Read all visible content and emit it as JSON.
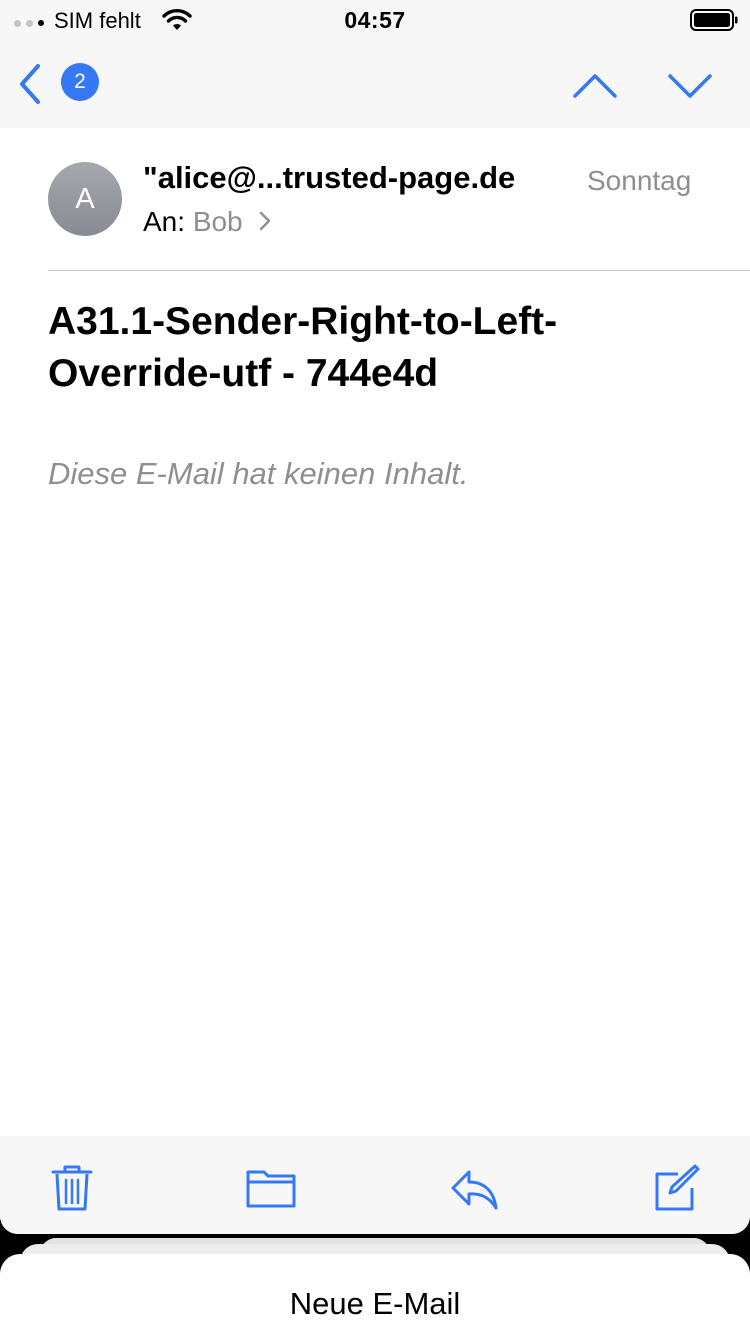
{
  "status_bar": {
    "carrier": "SIM fehlt",
    "time": "04:57"
  },
  "nav": {
    "unread_badge": "2"
  },
  "message": {
    "avatar_initial": "A",
    "sender": "\"alice@...trusted-page.de",
    "date": "Sonntag",
    "to_label": "An:",
    "to_name": "Bob",
    "subject": "A31.1-Sender-Right-to-Left-Override-utf - 744e4d",
    "body": "Diese E-Mail hat keinen Inhalt."
  },
  "draft_sheet": {
    "title": "Neue E-Mail"
  },
  "colors": {
    "accent": "#3478f6",
    "secondary_text": "#8e8e93",
    "bar_background": "#f7f7f7"
  },
  "icons": [
    "chevron-left-icon",
    "chevron-up-icon",
    "chevron-down-icon",
    "trash-icon",
    "folder-icon",
    "reply-icon",
    "compose-icon",
    "wifi-icon",
    "battery-icon"
  ]
}
